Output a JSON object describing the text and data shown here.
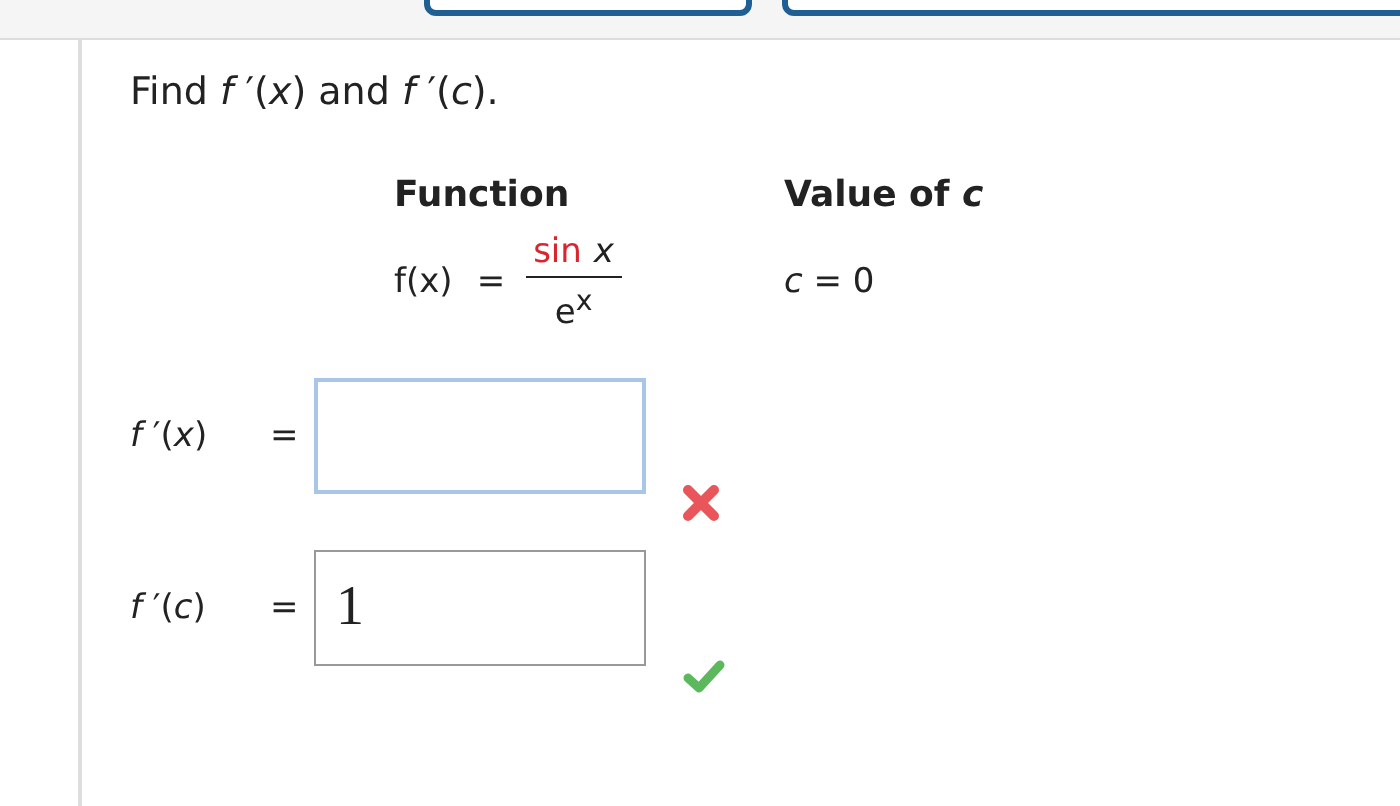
{
  "question": "Find *f* ′(*x*) and *f* ′(*c*).",
  "table": {
    "headers": [
      "Function",
      "Value of *c*"
    ],
    "function": {
      "lhs": "f(x)",
      "equals": "=",
      "numerator_function": "sin",
      "numerator_arg": "x",
      "denominator": "e$^{x}$"
    },
    "value": "*c* = 0"
  },
  "answers": [
    {
      "label": "*f* ′(*x*)",
      "equals": "=",
      "highlighted": true,
      "correct": false
    },
    {
      "label": "*f* ′(*c*)",
      "equals": "=",
      "value": "1",
      "highlighted": false,
      "correct": true
    }
  ]
}
